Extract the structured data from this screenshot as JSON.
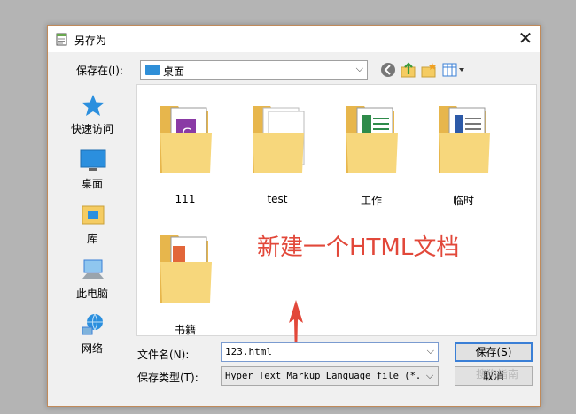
{
  "window": {
    "title": "另存为"
  },
  "toolbar": {
    "savein_label": "保存在(I):",
    "location": "桌面"
  },
  "places": [
    {
      "label": "快速访问",
      "icon": "star-icon"
    },
    {
      "label": "桌面",
      "icon": "desktop-icon"
    },
    {
      "label": "库",
      "icon": "library-icon"
    },
    {
      "label": "此电脑",
      "icon": "computer-icon"
    },
    {
      "label": "网络",
      "icon": "network-icon"
    }
  ],
  "files": [
    {
      "name": "111",
      "icon": "folder-icon"
    },
    {
      "name": "test",
      "icon": "folder-icon"
    },
    {
      "name": "工作",
      "icon": "folder-icon"
    },
    {
      "name": "临时",
      "icon": "folder-icon"
    },
    {
      "name": "书籍",
      "icon": "folder-icon"
    }
  ],
  "annotation": {
    "text": "新建一个HTML文档"
  },
  "form": {
    "filename_label": "文件名(N):",
    "filename_value": "123.html",
    "filetype_label": "保存类型(T):",
    "filetype_value": "Hyper Text Markup Language file (*.ht"
  },
  "buttons": {
    "save": "保存(S)",
    "cancel": "取消"
  },
  "watermark": "搜狗指南",
  "colors": {
    "accent": "#3a7fd6",
    "annotation": "#e2483a",
    "folder": "#f5cc62"
  }
}
